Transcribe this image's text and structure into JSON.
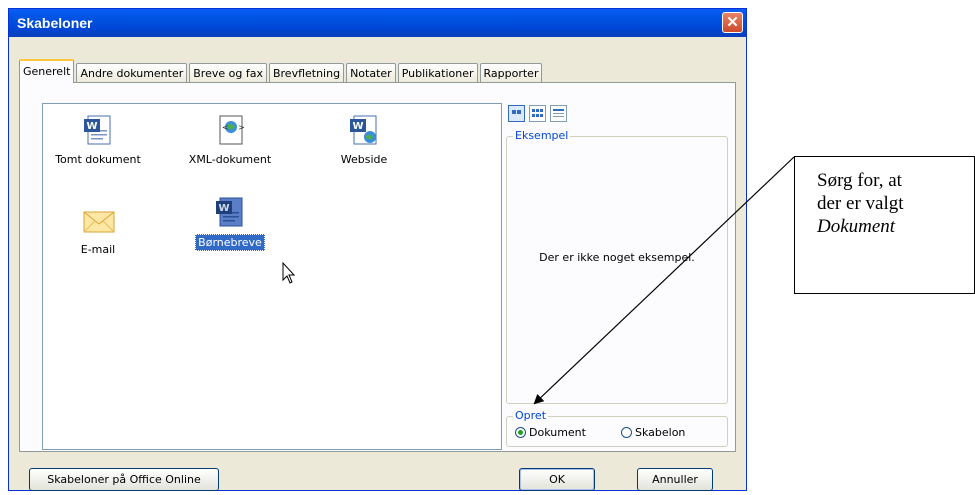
{
  "window": {
    "title": "Skabeloner",
    "close_glyph": "✕"
  },
  "tabs": [
    {
      "label": "Generelt",
      "active": true
    },
    {
      "label": "Andre dokumenter"
    },
    {
      "label": "Breve og fax"
    },
    {
      "label": "Brevfletning"
    },
    {
      "label": "Notater"
    },
    {
      "label": "Publikationer"
    },
    {
      "label": "Rapporter"
    }
  ],
  "templates": [
    {
      "label": "Tomt dokument",
      "icon": "word-document-icon"
    },
    {
      "label": "XML-dokument",
      "icon": "xml-document-icon"
    },
    {
      "label": "Webside",
      "icon": "web-page-icon"
    },
    {
      "label": "E-mail",
      "icon": "email-envelope-icon"
    },
    {
      "label": "Børnebreve",
      "icon": "word-document-icon",
      "selected": true
    }
  ],
  "view_buttons": [
    "large-icons-view",
    "small-icons-view",
    "details-view"
  ],
  "preview": {
    "title": "Eksempel",
    "empty_text": "Der er ikke noget eksempel."
  },
  "create": {
    "title": "Opret",
    "options": [
      {
        "label": "Dokument",
        "checked": true
      },
      {
        "label": "Skabelon",
        "checked": false
      }
    ]
  },
  "buttons": {
    "online": "Skabeloner på Office Online",
    "ok": "OK",
    "cancel": "Annuller"
  },
  "callout": {
    "line1": "Sørg for, at",
    "line2": "der er valgt",
    "line3": "Dokument"
  },
  "colors": {
    "title_bar": "#0054e3",
    "selection": "#316ac5",
    "dialog_bg": "#ece9d8"
  }
}
